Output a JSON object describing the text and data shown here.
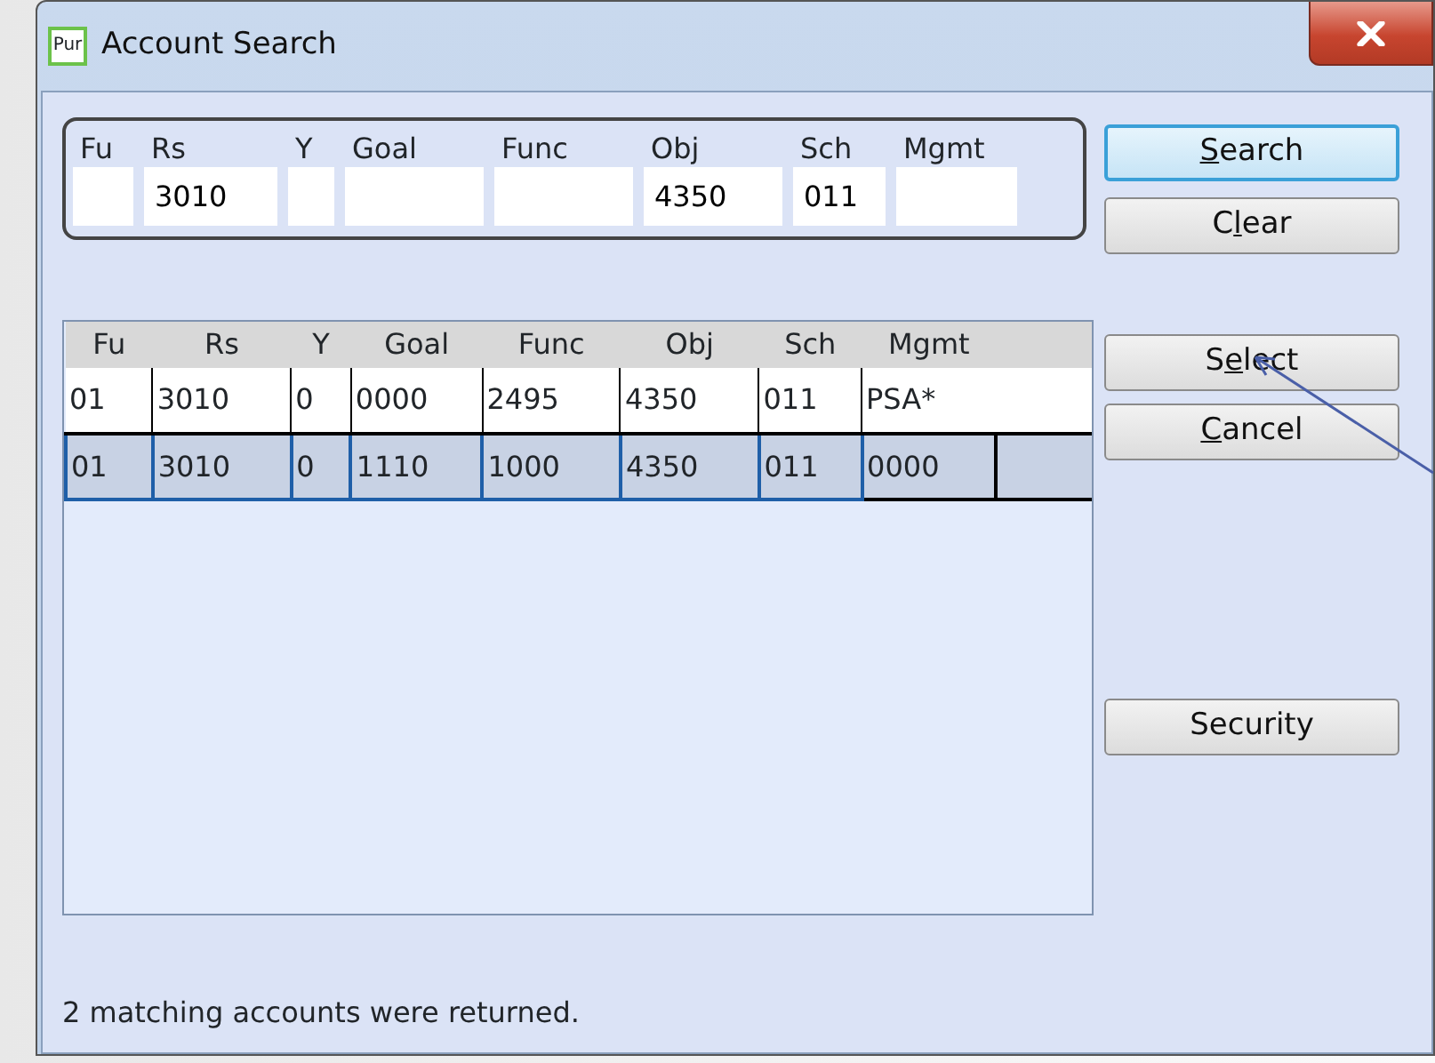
{
  "window": {
    "title": "Account Search",
    "app_icon": "Pur"
  },
  "query": {
    "fields": [
      {
        "label": "Fu"
      },
      {
        "label": "Rs",
        "value": "3010"
      },
      {
        "label": "Y"
      },
      {
        "label": "Goal"
      },
      {
        "label": "Func"
      },
      {
        "label": "Obj",
        "value": "4350"
      },
      {
        "label": "Sch",
        "value": "011"
      },
      {
        "label": "Mgmt"
      }
    ]
  },
  "top_buttons": [
    {
      "key": "S",
      "post": "earch",
      "default": true
    },
    {
      "pre": "C",
      "key": "l",
      "post": "ear",
      "default": false
    }
  ],
  "table": {
    "columns": [
      "Fu",
      "Rs",
      "Y",
      "Goal",
      "Func",
      "Obj",
      "Sch",
      "Mgmt"
    ],
    "rows": [
      {
        "selected": false,
        "cells": [
          {
            "text": "01",
            "focused": false
          },
          {
            "text": "3010",
            "focused": false
          },
          {
            "text": "0",
            "focused": false
          },
          {
            "text": "0000",
            "focused": false
          },
          {
            "text": "2495",
            "focused": false
          },
          {
            "text": "4350",
            "focused": false
          },
          {
            "text": "011",
            "focused": false
          },
          {
            "text": "PSA*",
            "focused": false
          }
        ]
      },
      {
        "selected": true,
        "cells": [
          {
            "text": "01",
            "focused": false
          },
          {
            "text": "3010",
            "focused": false
          },
          {
            "text": "0",
            "focused": false
          },
          {
            "text": "1110",
            "focused": false
          },
          {
            "text": "1000",
            "focused": false
          },
          {
            "text": "4350",
            "focused": false
          },
          {
            "text": "011",
            "focused": false
          },
          {
            "text": "0000",
            "focused": true
          }
        ]
      }
    ]
  },
  "side_buttons": [
    {
      "pre": "S",
      "key": "e",
      "post": "lect"
    },
    {
      "key": "C",
      "post": "ancel"
    }
  ],
  "security_button": {
    "pre": "Security"
  },
  "status": "2 matching accounts were returned."
}
